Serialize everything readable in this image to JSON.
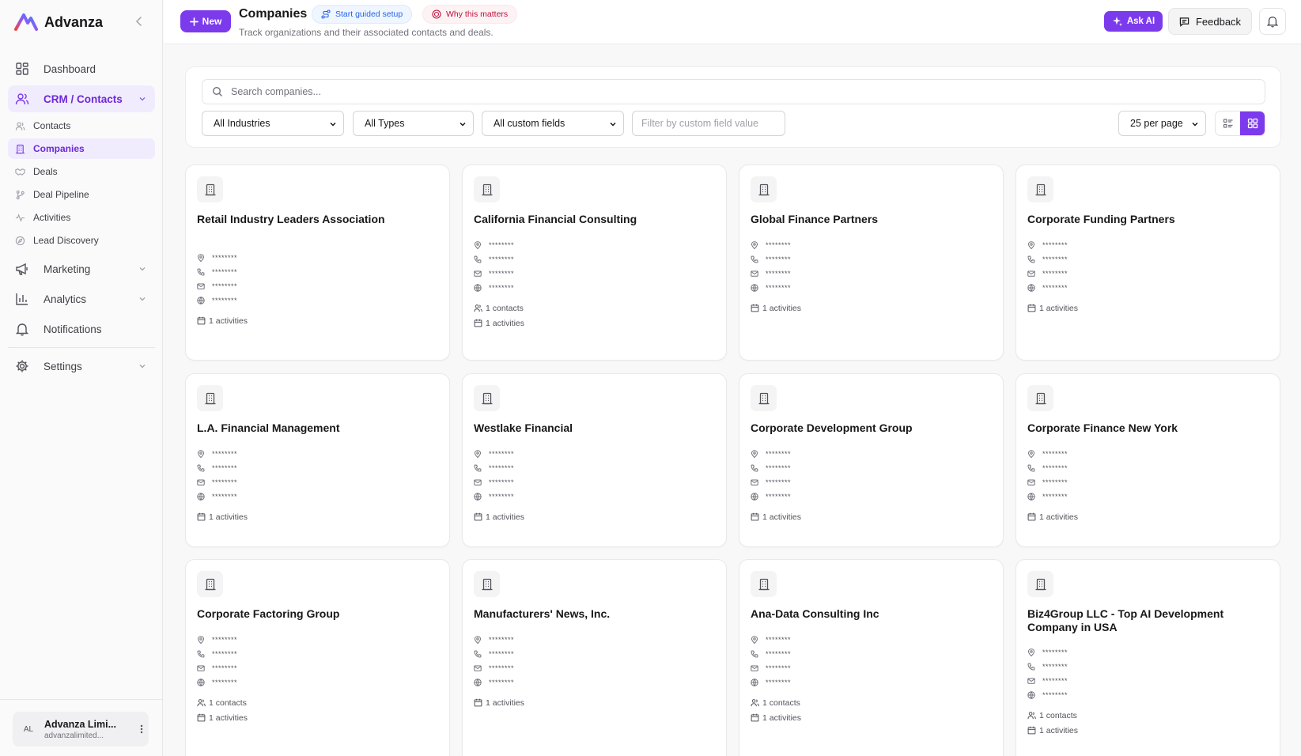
{
  "app": {
    "name": "Advanza"
  },
  "sidebar": {
    "nav": [
      {
        "label": "Dashboard",
        "icon": "dashboard-icon"
      },
      {
        "label": "CRM / Contacts",
        "icon": "users-icon"
      },
      {
        "label": "Marketing",
        "icon": "megaphone-icon"
      },
      {
        "label": "Analytics",
        "icon": "bar-chart-icon"
      },
      {
        "label": "Notifications",
        "icon": "bell-icon"
      },
      {
        "label": "Settings",
        "icon": "gear-icon"
      }
    ],
    "subnav": [
      {
        "label": "Contacts",
        "icon": "users-icon"
      },
      {
        "label": "Companies",
        "icon": "building-icon"
      },
      {
        "label": "Deals",
        "icon": "handshake-icon"
      },
      {
        "label": "Deal Pipeline",
        "icon": "git-branch-icon"
      },
      {
        "label": "Activities",
        "icon": "activity-icon"
      },
      {
        "label": "Lead Discovery",
        "icon": "compass-icon"
      }
    ],
    "user": {
      "initials": "AL",
      "name": "Advanza Limi...",
      "email": "advanzalimited..."
    }
  },
  "header": {
    "new_label": "New",
    "title": "Companies",
    "subtitle": "Track organizations and their associated contacts and deals.",
    "setup_label": "Start guided setup",
    "why_label": "Why this matters",
    "ask_ai_label": "Ask AI",
    "feedback_label": "Feedback"
  },
  "filters": {
    "search_placeholder": "Search companies...",
    "industry": "All Industries",
    "type": "All Types",
    "custom_field": "All custom fields",
    "custom_value_placeholder": "Filter by custom field value",
    "per_page": "25 per page"
  },
  "colors": {
    "accent": "#7c3aed",
    "accent_bg": "#f1ecfd"
  },
  "companies": [
    {
      "name": "Retail Industry Leaders Association",
      "fields": [
        "********",
        "********",
        "********",
        "********"
      ],
      "stats": [
        "1 activities"
      ]
    },
    {
      "name": "California Financial Consulting",
      "fields": [
        "********",
        "********",
        "********",
        "********"
      ],
      "stats": [
        "1 contacts",
        "1 activities"
      ]
    },
    {
      "name": "Global Finance Partners",
      "fields": [
        "********",
        "********",
        "********",
        "********"
      ],
      "stats": [
        "1 activities"
      ]
    },
    {
      "name": "Corporate Funding Partners",
      "fields": [
        "********",
        "********",
        "********",
        "********"
      ],
      "stats": [
        "1 activities"
      ]
    },
    {
      "name": "L.A. Financial Management",
      "fields": [
        "********",
        "********",
        "********",
        "********"
      ],
      "stats": [
        "1 activities"
      ]
    },
    {
      "name": "Westlake Financial",
      "fields": [
        "********",
        "********",
        "********",
        "********"
      ],
      "stats": [
        "1 activities"
      ]
    },
    {
      "name": "Corporate Development Group",
      "fields": [
        "********",
        "********",
        "********",
        "********"
      ],
      "stats": [
        "1 activities"
      ]
    },
    {
      "name": "Corporate Finance New York",
      "fields": [
        "********",
        "********",
        "********",
        "********"
      ],
      "stats": [
        "1 activities"
      ]
    },
    {
      "name": "Corporate Factoring Group",
      "fields": [
        "********",
        "********",
        "********",
        "********"
      ],
      "stats": [
        "1 contacts",
        "1 activities"
      ]
    },
    {
      "name": "Manufacturers' News, Inc.",
      "fields": [
        "********",
        "********",
        "********",
        "********"
      ],
      "stats": [
        "1 activities"
      ]
    },
    {
      "name": "Ana-Data Consulting Inc",
      "fields": [
        "********",
        "********",
        "********",
        "********"
      ],
      "stats": [
        "1 contacts",
        "1 activities"
      ]
    },
    {
      "name": "Biz4Group LLC - Top AI Development Company in USA",
      "fields": [
        "********",
        "********",
        "********",
        "********"
      ],
      "stats": [
        "1 contacts",
        "1 activities"
      ]
    }
  ]
}
